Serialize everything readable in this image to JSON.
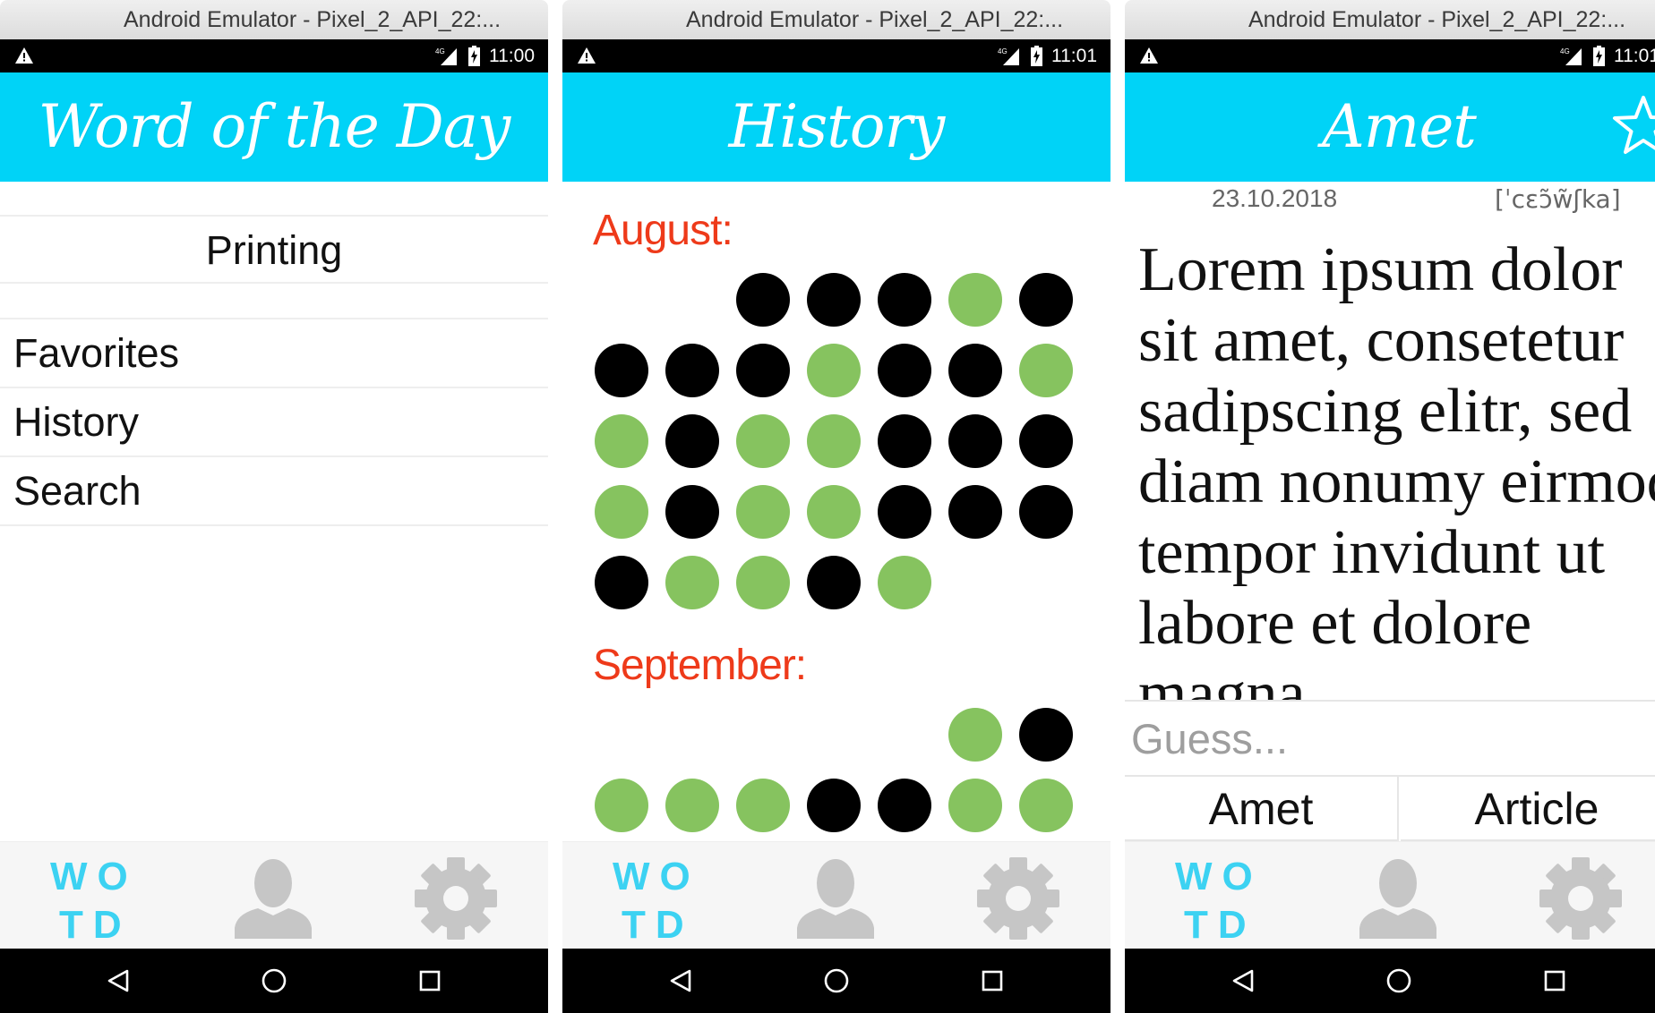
{
  "windows": [
    {
      "window_title": "Android Emulator - Pixel_2_API_22:...",
      "time": "11:00",
      "app_title": "Word of the Day",
      "menu": {
        "current_word": "Printing",
        "items": [
          "Favorites",
          "History",
          "Search"
        ]
      }
    },
    {
      "window_title": "Android Emulator - Pixel_2_API_22:...",
      "time": "11:01",
      "app_title": "History",
      "months": [
        {
          "label": "August:",
          "days": [
            "",
            "",
            "x",
            "x",
            "x",
            "o",
            "x",
            "x",
            "x",
            "x",
            "o",
            "x",
            "x",
            "o",
            "o",
            "x",
            "o",
            "o",
            "x",
            "x",
            "x",
            "o",
            "x",
            "o",
            "o",
            "x",
            "x",
            "x",
            "x",
            "o",
            "o",
            "x",
            "o"
          ]
        },
        {
          "label": "September:",
          "days": [
            "",
            "",
            "",
            "",
            "",
            "o",
            "x",
            "o",
            "o",
            "o",
            "x",
            "x",
            "o",
            "o"
          ]
        }
      ],
      "legend_colors": {
        "guessed": "#86c35f",
        "missed": "#000000"
      }
    },
    {
      "window_title": "Android Emulator - Pixel_2_API_22:...",
      "time": "11:01",
      "app_title": "Amet",
      "date": "23.10.2018",
      "pronunciation": "[ˈcɛɔ̃w̃ʃka]",
      "definition": "Lorem ipsum dolor sit amet, consetetur sadipscing elitr, sed diam nonumy eirmod tempor invidunt ut labore et dolore magna",
      "guess_placeholder": "Guess...",
      "choices": [
        "Amet",
        "Article"
      ]
    }
  ],
  "tabbar": {
    "logo_line1": "WO",
    "logo_line2": "TD",
    "icons": [
      "wotd-logo-icon",
      "person-icon",
      "gear-icon"
    ]
  },
  "navbar_icons": [
    "back-icon",
    "home-icon",
    "recent-apps-icon"
  ],
  "colors": {
    "app_bar": "#00d3f7",
    "month_label": "#ee3a1a",
    "logo": "#3cd2f2",
    "tab_icon_gray": "#c6c6c6"
  }
}
